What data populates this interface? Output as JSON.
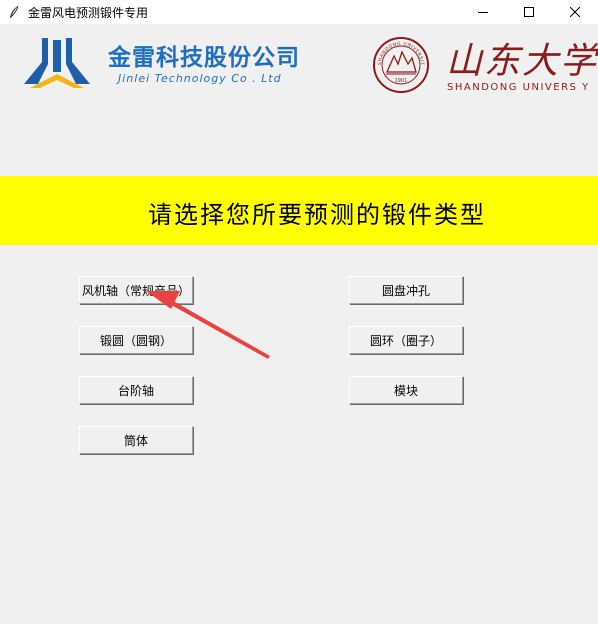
{
  "window": {
    "title": "金雷风电预测锻件专用",
    "controls": [
      "minimize",
      "maximize",
      "close"
    ]
  },
  "header": {
    "company_logo_icon": "jinlei-logo",
    "company_name_cn": "金雷科技股份公司",
    "company_name_en": "Jinlei Technology Co . Ltd",
    "university_seal_icon": "shandong-university-seal",
    "university_seal_text": "SHANDONG UNIVERSITY",
    "university_seal_year": "1901",
    "university_name_cn": "山东大学",
    "university_name_en": "SHANDONG UNIVERS   Y"
  },
  "banner": {
    "text": "请选择您所要预测的锻件类型",
    "color": "#ffff00"
  },
  "buttons": {
    "wind_shaft": "风机轴（常规产品）",
    "forged_round": "锻圆（圆钢）",
    "step_shaft": "台阶轴",
    "cylinder": "筒体",
    "disc_punch": "圆盘冲孔",
    "ring": "圆环（圈子）",
    "module_block": "模块"
  },
  "annotation": {
    "arrow_color": "#e8433f",
    "points_to": "wind_shaft"
  }
}
